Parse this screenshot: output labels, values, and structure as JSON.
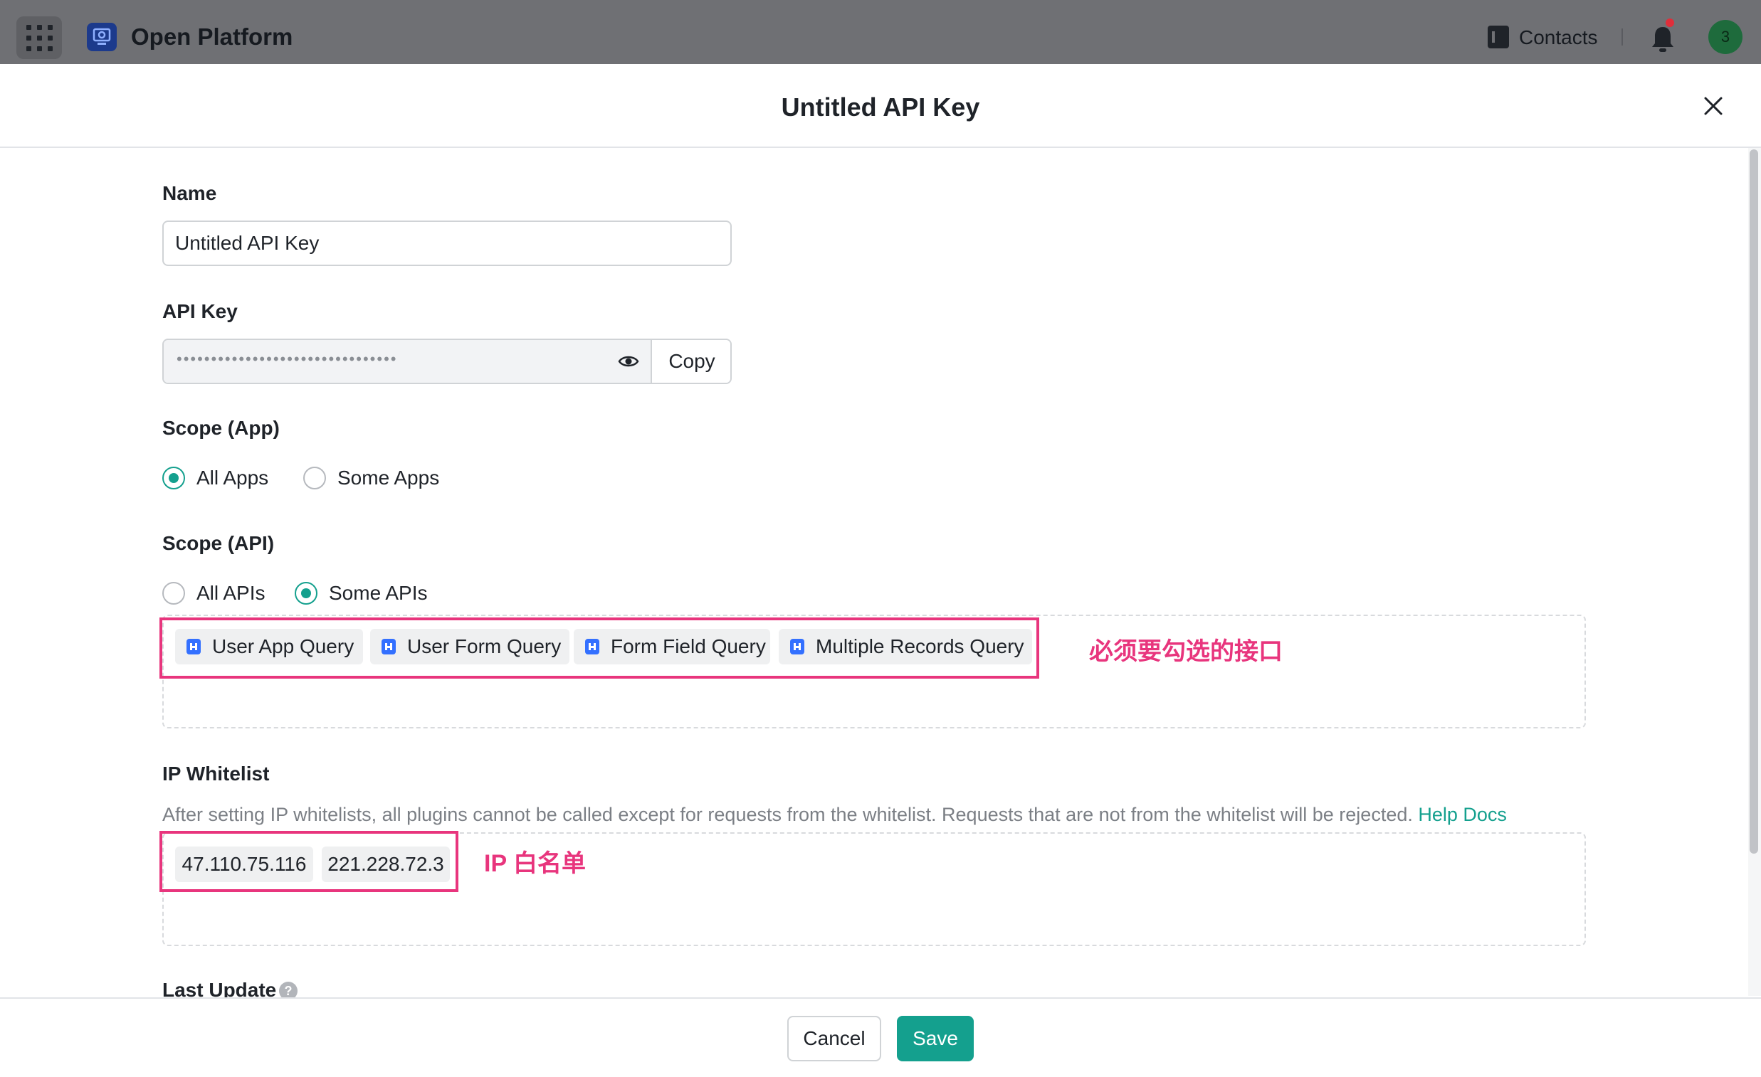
{
  "topbar": {
    "title": "Open Platform",
    "contacts_label": "Contacts",
    "avatar_badge": "3",
    "icons": [
      "app-grid-icon",
      "platform-logo-icon",
      "contacts-icon",
      "bell-icon"
    ]
  },
  "modal": {
    "title": "Untitled API Key",
    "close_icon": "close-icon"
  },
  "form": {
    "name": {
      "label": "Name",
      "value": "Untitled API Key"
    },
    "api_key": {
      "label": "API Key",
      "masked_value": "••••••••••••••••••••••••••••••••",
      "copy_label": "Copy",
      "reveal_icon": "eye-icon"
    },
    "scope_app": {
      "label": "Scope (App)",
      "options": [
        "All Apps",
        "Some Apps"
      ],
      "selected": "All Apps"
    },
    "scope_api": {
      "label": "Scope (API)",
      "options": [
        "All APIs",
        "Some APIs"
      ],
      "selected": "Some APIs",
      "selected_apis": [
        "User App Query",
        "User Form Query",
        "Form Field Query",
        "Multiple Records Query"
      ]
    },
    "ip_whitelist": {
      "label": "IP Whitelist",
      "description": "After setting IP whitelists, all plugins cannot be called except for requests from the whitelist. Requests that are not from the whitelist will be rejected.",
      "help_link": "Help Docs",
      "ips": [
        "47.110.75.116",
        "221.228.72.3"
      ]
    },
    "last_update": {
      "label": "Last Update",
      "help_icon": "?"
    }
  },
  "annotations": {
    "apis_note": "必须要勾选的接口",
    "ip_note": "IP 白名单",
    "color": "#e8357d"
  },
  "footer": {
    "cancel_label": "Cancel",
    "save_label": "Save"
  },
  "colors": {
    "accent": "#14a08e",
    "topbar": "#6f7074",
    "annotation": "#e8357d"
  }
}
